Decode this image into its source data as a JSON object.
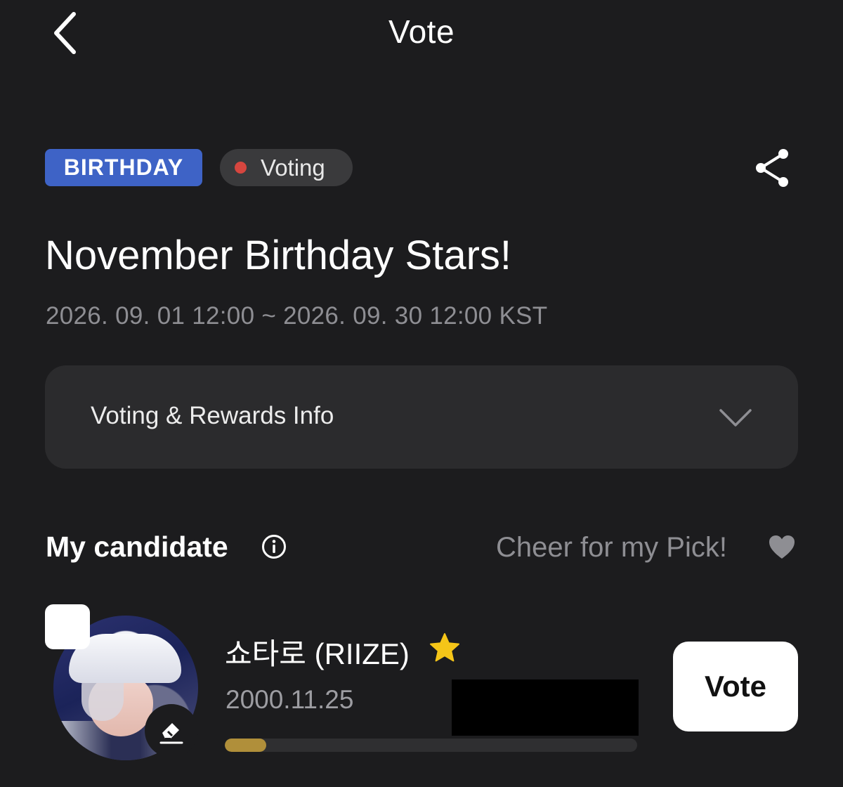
{
  "header": {
    "title": "Vote",
    "back_icon": "chevron-left-icon"
  },
  "event": {
    "category_tag": "BIRTHDAY",
    "status_label": "Voting",
    "status_dot_color": "#d6463f",
    "category_color": "#3e63c6",
    "share_icon": "share-icon",
    "title": "November Birthday Stars!",
    "period": "2026. 09. 01 12:00 ~ 2026. 09. 30 12:00 KST"
  },
  "info_section": {
    "label": "Voting & Rewards Info",
    "expanded": false
  },
  "my_candidate": {
    "section_title": "My candidate",
    "cheer_text": "Cheer for my Pick!",
    "candidate": {
      "name": "쇼타로 (RIIZE)",
      "birth_date": "2000.11.25",
      "progress": 0.1,
      "progress_color": "#b08f3a",
      "selected": false,
      "vote_button_label": "Vote"
    }
  }
}
